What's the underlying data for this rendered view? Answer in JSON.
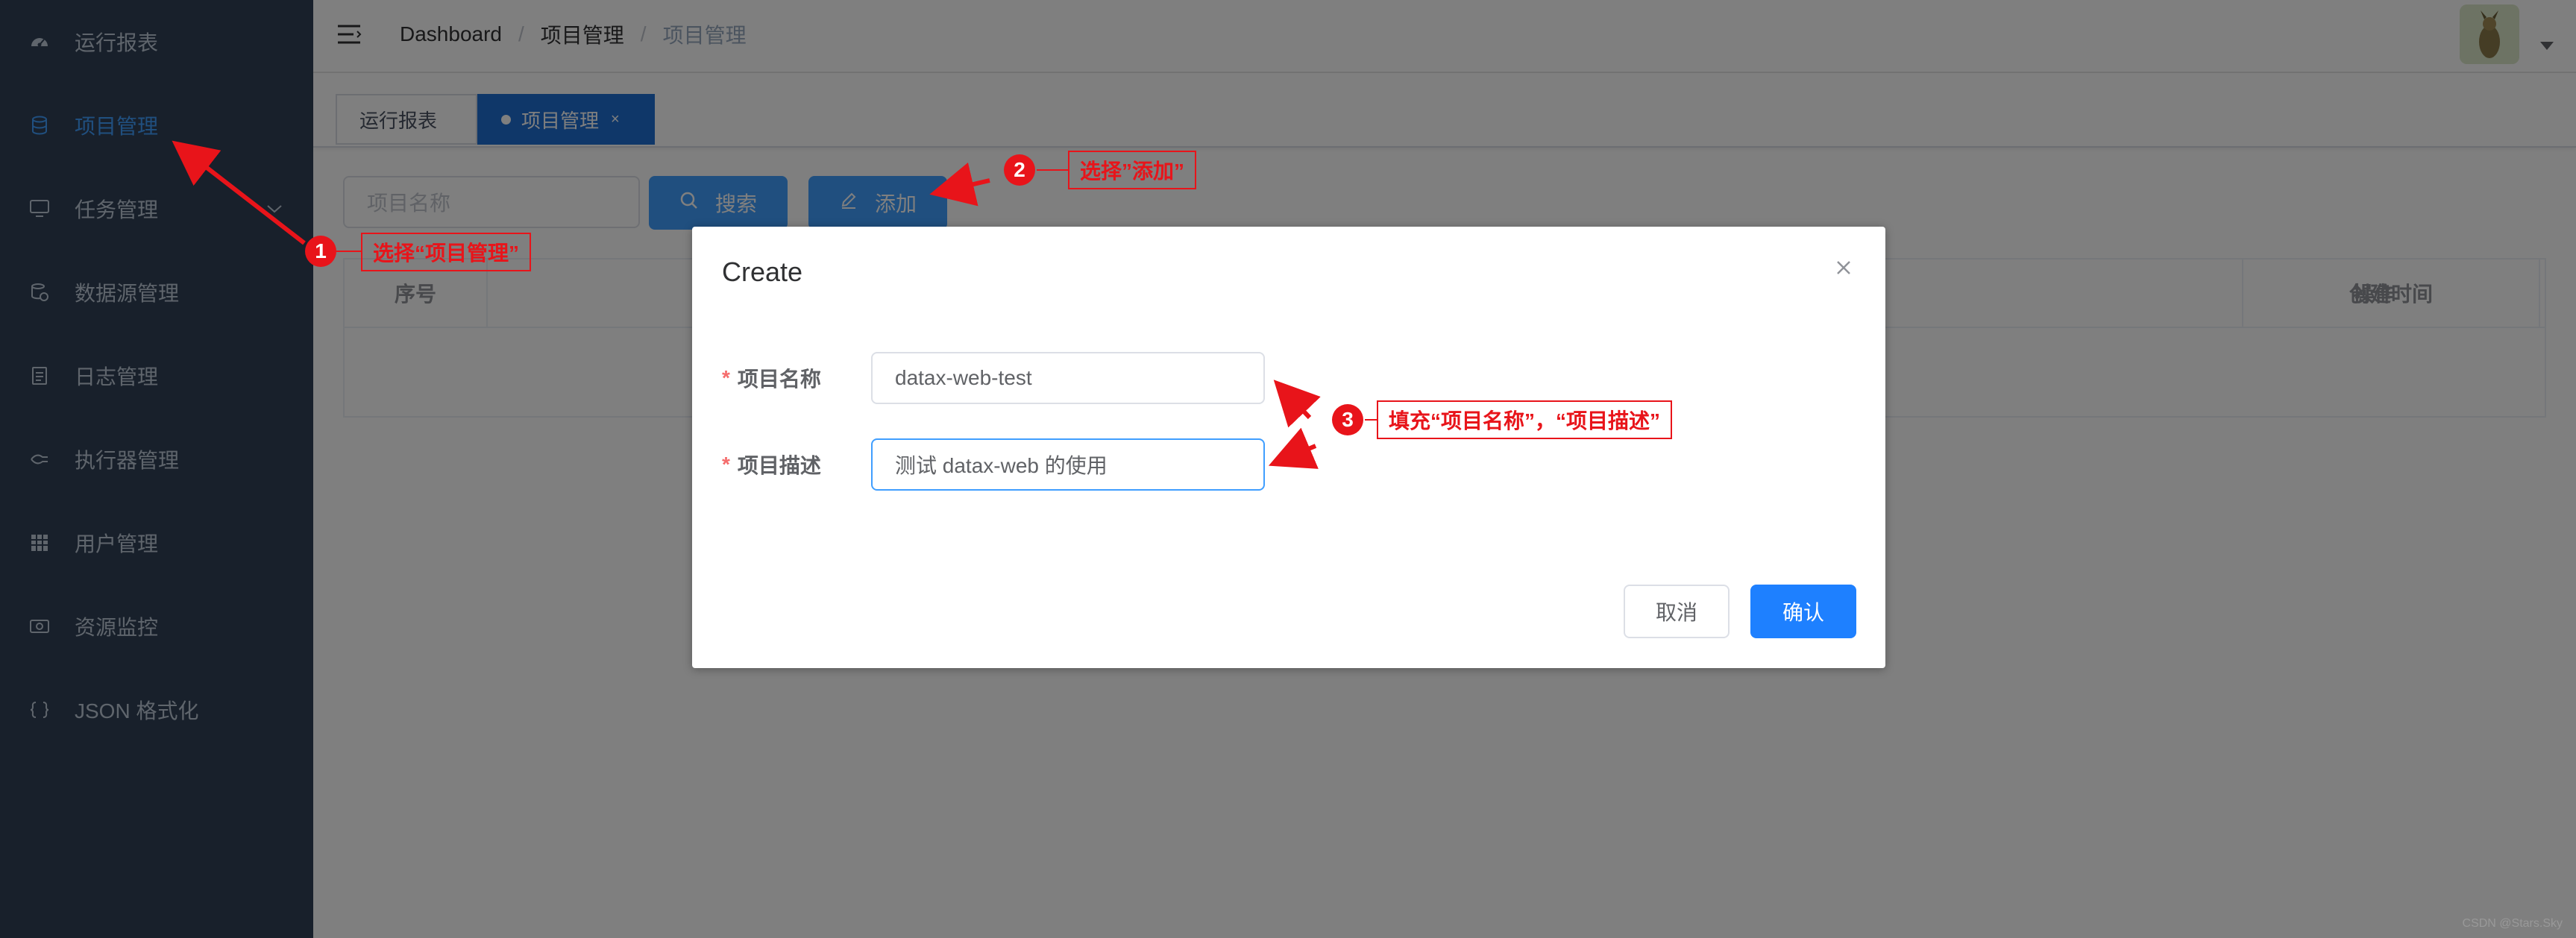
{
  "sidebar": {
    "items": [
      {
        "label": "运行报表",
        "icon": "dashboard-icon"
      },
      {
        "label": "项目管理",
        "icon": "database-icon"
      },
      {
        "label": "任务管理",
        "icon": "monitor-icon"
      },
      {
        "label": "数据源管理",
        "icon": "datasource-icon"
      },
      {
        "label": "日志管理",
        "icon": "document-icon"
      },
      {
        "label": "执行器管理",
        "icon": "executor-icon"
      },
      {
        "label": "用户管理",
        "icon": "table-icon"
      },
      {
        "label": "资源监控",
        "icon": "money-icon"
      },
      {
        "label": "JSON 格式化",
        "icon": "json-icon"
      }
    ]
  },
  "breadcrumb": {
    "items": [
      "Dashboard",
      "项目管理",
      "项目管理"
    ],
    "sep": "/"
  },
  "tags": {
    "items": [
      {
        "label": "运行报表"
      },
      {
        "label": "项目管理",
        "close": "×"
      }
    ]
  },
  "toolbar": {
    "search_placeholder": "项目名称",
    "search_label": "搜索",
    "add_label": "添加"
  },
  "table": {
    "columns": [
      "序号",
      "创建时间",
      "操作"
    ]
  },
  "dialog": {
    "title": "Create",
    "close": "×",
    "fields": [
      {
        "label": "项目名称",
        "value": "datax-web-test",
        "required": "*"
      },
      {
        "label": "项目描述",
        "value": "测试 datax-web 的使用",
        "required": "*"
      }
    ],
    "cancel_label": "取消",
    "confirm_label": "确认"
  },
  "annotations": [
    {
      "num": "1",
      "text": "选择“项目管理”"
    },
    {
      "num": "2",
      "text": "选择”添加”"
    },
    {
      "num": "3",
      "text": "填充“项目名称”，“项目描述”"
    }
  ],
  "watermark": "CSDN @Stars.Sky",
  "colors": {
    "sidebar_bg": "#304156",
    "primary": "#409eff",
    "annotation": "#e8141a"
  }
}
